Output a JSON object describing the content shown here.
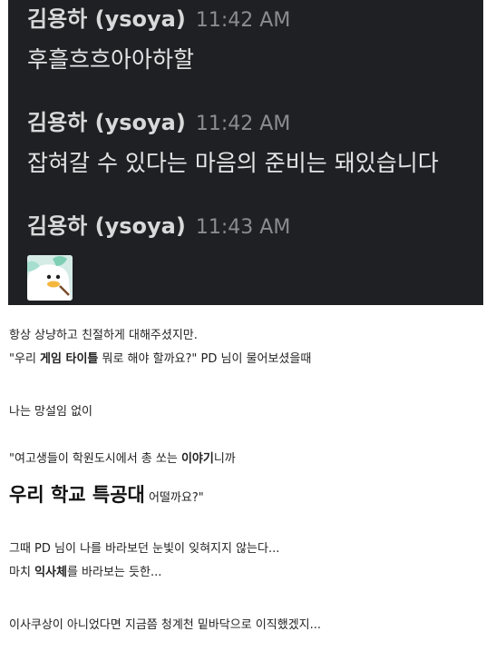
{
  "chat": {
    "messages": [
      {
        "author": "김용하 (ysoya)",
        "time": "11:42 AM",
        "text": "후흘흐흐아아하할"
      },
      {
        "author": "김용하 (ysoya)",
        "time": "11:42 AM",
        "text": "잡혀갈 수 있다는 마음의 준비는 돼있습니다"
      },
      {
        "author": "김용하 (ysoya)",
        "time": "11:43 AM",
        "sticker": "duck-sticker-icon"
      }
    ]
  },
  "post": {
    "line1": "항상 상냥하고 친절하게 대해주셨지만.",
    "line2": {
      "p1": " \"우리 ",
      "p2": "게임 타이틀",
      "p3": " 뭐로 해야 할까요?\" PD 님이 물어보셨을때"
    },
    "line3": "나는 망설임 없이",
    "line4": {
      "p1": "\"여고생들이 학원도시에서 총 쏘는 ",
      "p2": "이야기",
      "p3": "니까"
    },
    "line5": {
      "big": "우리 학교 특공대",
      "rest": " 어떨까요?\""
    },
    "line6": "그때 PD 님이 나를 바라보던 눈빛이 잊혀지지 않는다...",
    "line7": {
      "p1": "마치 ",
      "p2": "익사체",
      "p3": "를 바라보는 듯한..."
    },
    "line8": "이사쿠상이 아니었다면 지금쯤 청계천 밑바닥으로 이직했겠지..."
  }
}
